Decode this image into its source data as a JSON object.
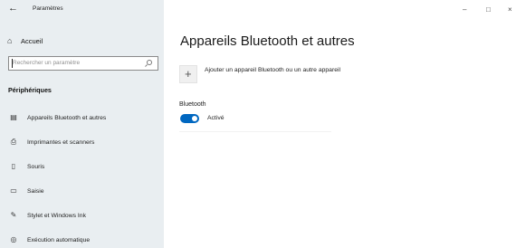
{
  "window": {
    "title": "Paramètres",
    "back_glyph": "←",
    "controls": {
      "minimize": "–",
      "maximize": "□",
      "close": "×"
    }
  },
  "sidebar": {
    "home": {
      "label": "Accueil",
      "icon": "home-icon",
      "glyph": "⌂"
    },
    "search": {
      "placeholder": "Rechercher un paramètre",
      "icon": "search-icon"
    },
    "section_title": "Périphériques",
    "items": [
      {
        "label": "Appareils Bluetooth et autres",
        "icon": "bluetooth-devices-icon",
        "glyph": "▤"
      },
      {
        "label": "Imprimantes et scanners",
        "icon": "printer-icon",
        "glyph": "⎙"
      },
      {
        "label": "Souris",
        "icon": "mouse-icon",
        "glyph": "▯"
      },
      {
        "label": "Saisie",
        "icon": "keyboard-icon",
        "glyph": "▭"
      },
      {
        "label": "Stylet et Windows Ink",
        "icon": "pen-icon",
        "glyph": "✎"
      },
      {
        "label": "Exécution automatique",
        "icon": "autoplay-icon",
        "glyph": "◎"
      }
    ]
  },
  "main": {
    "title": "Appareils Bluetooth et autres",
    "add_device": {
      "icon": "plus-icon",
      "glyph": "+",
      "label": "Ajouter un appareil Bluetooth ou un autre appareil"
    },
    "bluetooth": {
      "heading": "Bluetooth",
      "toggle_on": true,
      "toggle_label": "Activé"
    }
  },
  "colors": {
    "sidebar_bg": "#e9eef1",
    "accent": "#0067c0"
  }
}
